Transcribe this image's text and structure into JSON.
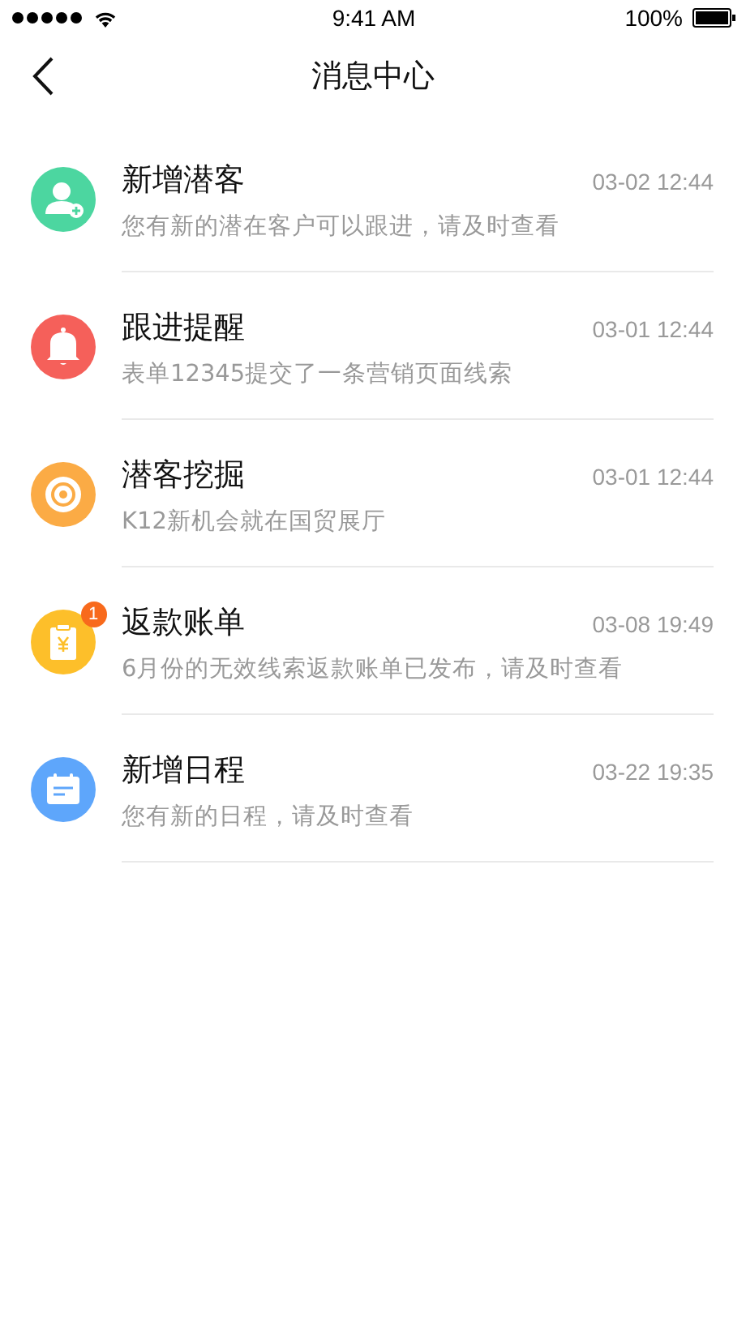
{
  "status_bar": {
    "time": "9:41 AM",
    "battery": "100%"
  },
  "nav": {
    "title": "消息中心"
  },
  "messages": [
    {
      "kind": "person",
      "color": "#4cd6a0",
      "title": "新增潜客",
      "time": "03-02 12:44",
      "text": "您有新的潜在客户可以跟进，请及时查看"
    },
    {
      "kind": "bell",
      "color": "#f5605a",
      "title": "跟进提醒",
      "time": "03-01 12:44",
      "text": "表单12345提交了一条营销页面线索"
    },
    {
      "kind": "target",
      "color": "#fbab45",
      "title": "潜客挖掘",
      "time": "03-01 12:44",
      "text": "K12新机会就在国贸展厅"
    },
    {
      "kind": "bill",
      "color": "#fdbf2a",
      "title": "返款账单",
      "time": "03-08 19:49",
      "text": "6月份的无效线索返款账单已发布，请及时查看",
      "badge": "1"
    },
    {
      "kind": "calendar",
      "color": "#5ea6fb",
      "title": "新增日程",
      "time": "03-22 19:35",
      "text": "您有新的日程，请及时查看"
    }
  ]
}
